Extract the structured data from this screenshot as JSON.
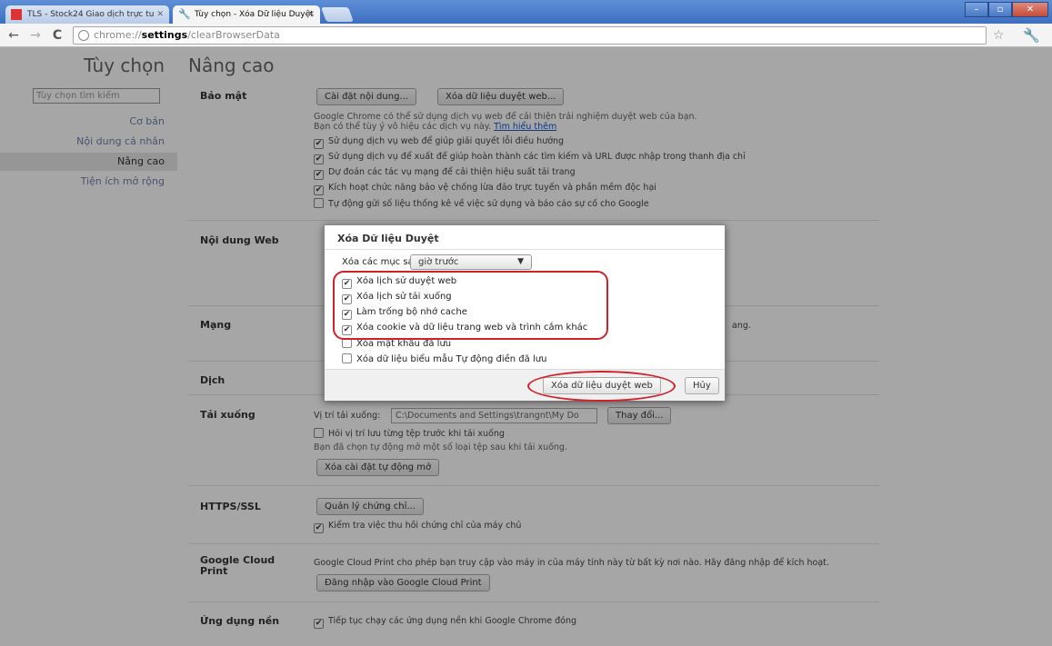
{
  "tabs": [
    {
      "label": "TLS - Stock24 Giao dịch trực tu",
      "active": false
    },
    {
      "label": "Tùy chọn - Xóa Dữ liệu Duyệt",
      "active": true
    }
  ],
  "window_controls": {
    "minimize": "–",
    "maximize": "▫",
    "close": "✕"
  },
  "address_bar": {
    "scheme": "chrome://",
    "host": "settings",
    "path": "/clearBrowserData"
  },
  "sidebar": {
    "title": "Tùy chọn",
    "search_placeholder": "Tùy chọn tìm kiếm",
    "items": [
      {
        "label": "Cơ bản"
      },
      {
        "label": "Nội dung cá nhân"
      },
      {
        "label": "Nâng cao"
      },
      {
        "label": "Tiện ích mở rộng"
      }
    ]
  },
  "main": {
    "title": "Nâng cao",
    "privacy": {
      "label": "Bảo mật",
      "btn_content": "Cài đặt nội dung...",
      "btn_clear": "Xóa dữ liệu duyệt web...",
      "desc1": "Google Chrome có thể sử dụng dịch vụ web để cải thiện trải nghiệm duyệt web của bạn.",
      "desc2": "Bạn có thể tùy ý vô hiệu các dịch vụ này.",
      "learn_more": "Tìm hiểu thêm",
      "options": [
        {
          "label": "Sử dụng dịch vụ web để giúp giải quyết lỗi điều hướng",
          "checked": true
        },
        {
          "label": "Sử dụng dịch vụ để xuất để giúp hoàn thành các tìm kiếm và URL được nhập trong thanh địa chỉ",
          "checked": true
        },
        {
          "label": "Dự đoán các tác vụ mạng để cải thiện hiệu suất tải trang",
          "checked": true
        },
        {
          "label": "Kích hoạt chức năng bảo vệ chống lừa đảo trực tuyến và phần mềm độc hại",
          "checked": true
        },
        {
          "label": "Tự động gửi số liệu thống kê về việc sử dụng và báo cáo sự cố cho Google",
          "checked": false
        }
      ]
    },
    "web_content": {
      "label": "Nội dung Web"
    },
    "network": {
      "label": "Mạng",
      "partial_text": "ang."
    },
    "translate": {
      "label": "Dịch"
    },
    "downloads": {
      "label": "Tải xuống",
      "location_label": "Vị trí tải xuống:",
      "location_value": "C:\\Documents and Settings\\trangnt\\My Do",
      "btn_change": "Thay đổi...",
      "ask_option": "Hỏi vị trí lưu từng tệp trước khi tải xuống",
      "auto_open_text": "Bạn đã chọn tự động mở một số loại tệp sau khi tải xuống.",
      "btn_clear_auto": "Xóa cài đặt tự động mở"
    },
    "https": {
      "label": "HTTPS/SSL",
      "btn_manage": "Quản lý chứng chỉ...",
      "revocation": "Kiểm tra việc thu hồi chứng chỉ của máy chủ"
    },
    "cloud_print": {
      "label": "Google Cloud Print",
      "desc": "Google Cloud Print cho phép bạn truy cập vào máy in của máy tính này từ bất kỳ nơi nào. Hãy đăng nhập để kích hoạt.",
      "btn_signin": "Đăng nhập vào Google Cloud Print"
    },
    "background_apps": {
      "label": "Ứng dụng nền",
      "option": "Tiếp tục chạy các ứng dụng nền khi Google Chrome đóng"
    }
  },
  "dialog": {
    "title": "Xóa Dữ liệu Duyệt",
    "period_label": "Xóa các mục sau khỏi:",
    "period_value": "giờ trước",
    "items": [
      {
        "label": "Xóa lịch sử duyệt web",
        "checked": true
      },
      {
        "label": "Xóa lịch sử tải xuống",
        "checked": true
      },
      {
        "label": "Làm trống bộ nhớ cache",
        "checked": true
      },
      {
        "label": "Xóa cookie và dữ liệu trang web và trình cắm khác",
        "checked": true
      },
      {
        "label": "Xóa mật khẩu đã lưu",
        "checked": false
      },
      {
        "label": "Xóa dữ liệu biểu mẫu Tự động điền đã lưu",
        "checked": false
      }
    ],
    "btn_clear": "Xóa dữ liệu duyệt web",
    "btn_cancel": "Hủy"
  },
  "annotation_color": "#d0202a"
}
